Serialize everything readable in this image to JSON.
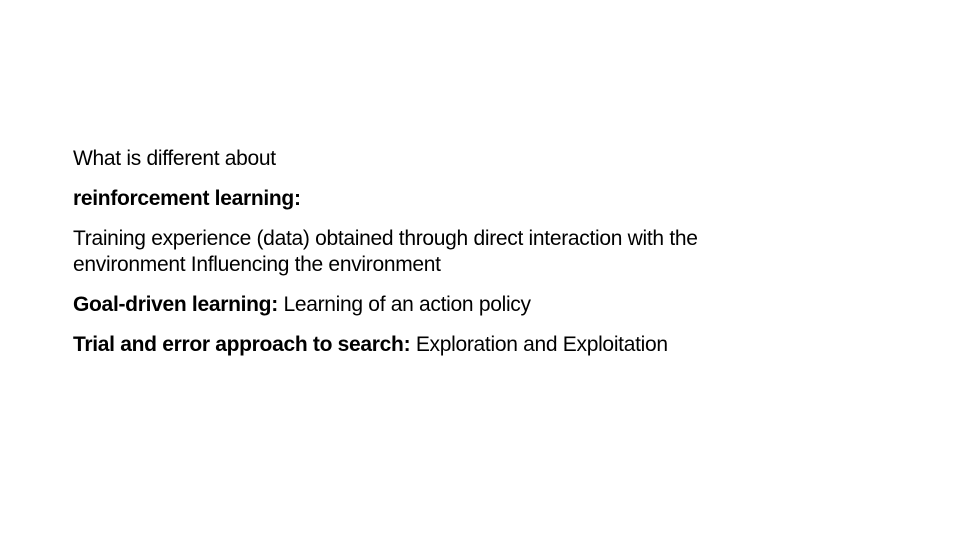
{
  "slide": {
    "lines": [
      {
        "bold": "",
        "text": "What is different about"
      },
      {
        "bold": "reinforcement learning:",
        "text": ""
      },
      {
        "bold": "",
        "text": "Training experience (data) obtained through direct interaction with the"
      },
      {
        "bold": "",
        "text": "environment Influencing the environment"
      },
      {
        "bold": "Goal-driven learning:",
        "text": " Learning of an action policy"
      },
      {
        "bold": "Trial and error approach to search:",
        "text": " Exploration and Exploitation"
      }
    ]
  }
}
